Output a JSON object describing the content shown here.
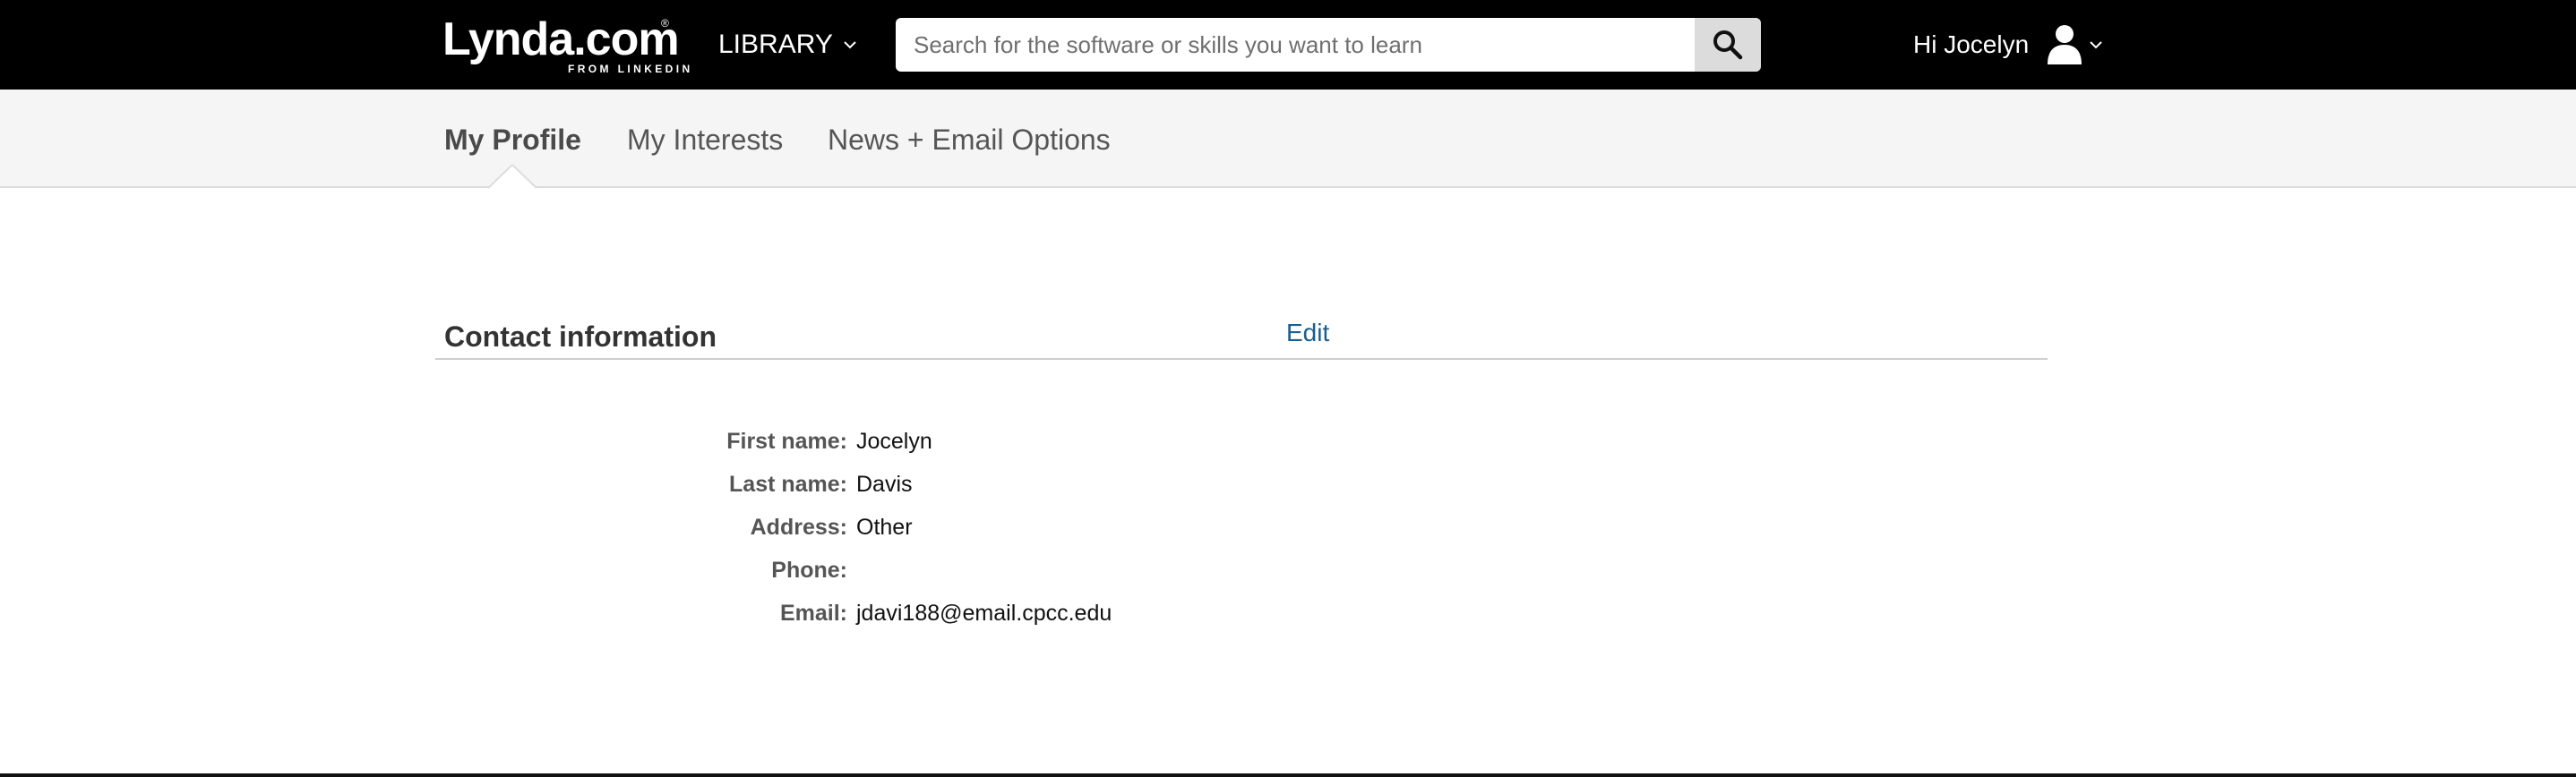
{
  "header": {
    "logo_main": "Lynda.com",
    "logo_sub": "FROM LINKEDIN",
    "logo_reg": "®",
    "library_label": "LIBRARY",
    "search_placeholder": "Search for the software or skills you want to learn",
    "search_value": "",
    "greeting": "Hi Jocelyn",
    "icons": {
      "library_chevron": "chevron-down-icon",
      "search": "search-icon",
      "user": "user-icon",
      "user_chevron": "chevron-down-icon"
    }
  },
  "tabs": [
    {
      "label": "My Profile",
      "active": true
    },
    {
      "label": "My Interests",
      "active": false
    },
    {
      "label": "News + Email Options",
      "active": false
    }
  ],
  "contact": {
    "title": "Contact information",
    "edit_label": "Edit",
    "fields": [
      {
        "label": "First name:",
        "value": "Jocelyn"
      },
      {
        "label": "Last name:",
        "value": "Davis"
      },
      {
        "label": "Address:",
        "value": "Other"
      },
      {
        "label": "Phone:",
        "value": ""
      },
      {
        "label": "Email:",
        "value": "jdavi188@email.cpcc.edu"
      }
    ]
  },
  "colors": {
    "topbar": "#000000",
    "subnav": "#f5f5f5",
    "link": "#1a5f8f",
    "search_button": "#dcdcdc"
  }
}
